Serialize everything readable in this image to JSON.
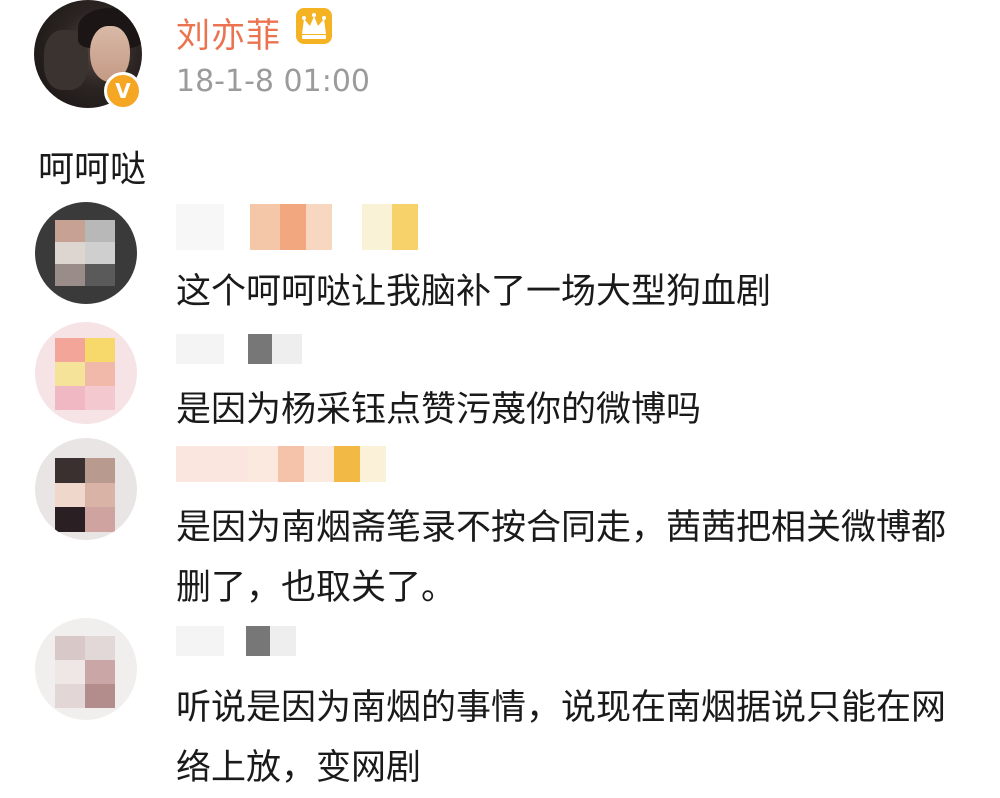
{
  "post": {
    "author_name": "刘亦菲",
    "crown_icon": "crown-icon",
    "verified_badge": "V",
    "timestamp": "18-1-8 01:00",
    "text": "呵呵哒"
  },
  "comments": [
    {
      "text": "这个呵呵哒让我脑补了一场大型狗血剧"
    },
    {
      "text": "是因为杨采钰点赞污蔑你的微博吗"
    },
    {
      "text": "是因为南烟斋笔录不按合同走，茜茜把相关微博都删了，也取关了。"
    },
    {
      "text": "听说是因为南烟的事情，说现在南烟据说只能在网络上放，变网剧"
    }
  ],
  "colors": {
    "author_name": "#eb7350",
    "timestamp": "#9b9b9b",
    "verified_badge": "#f5a623",
    "crown": "#f5b323"
  }
}
